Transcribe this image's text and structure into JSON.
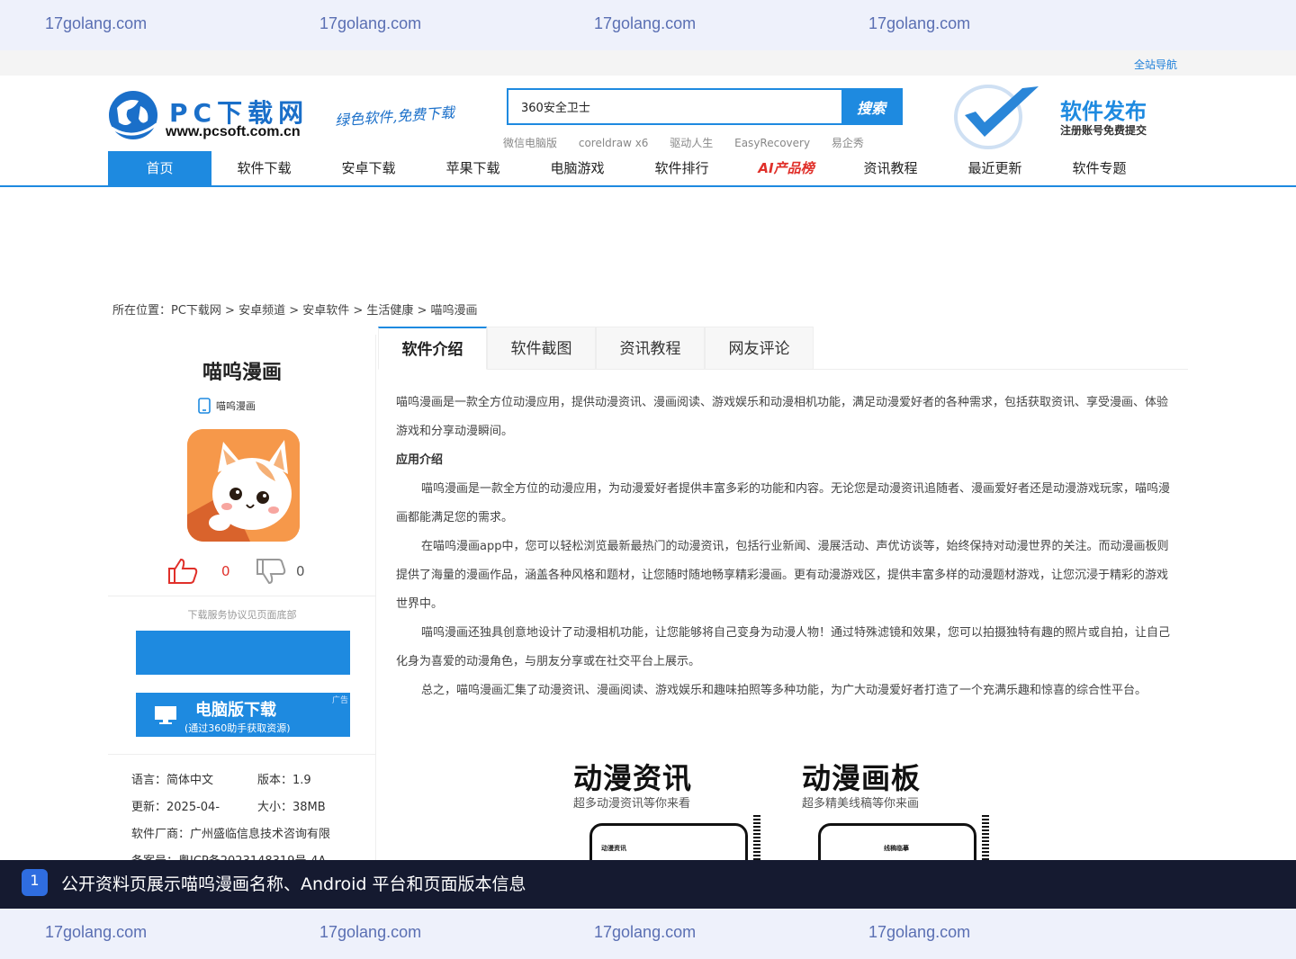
{
  "watermark": {
    "text": "17golang.com"
  },
  "topstrip": {
    "nav_all": "全站导航"
  },
  "header": {
    "logo_text": "PC下载网",
    "logo_url": "www.pcsoft.com.cn",
    "slogan": "绿色软件,免费下载",
    "search_value": "360安全卫士",
    "search_button": "搜索",
    "hot_words": [
      "微信电脑版",
      "coreldraw x6",
      "驱动人生",
      "EasyRecovery",
      "易企秀"
    ],
    "promo_title": "软件发布",
    "promo_sub": "注册账号免费提交"
  },
  "nav": {
    "items": [
      "首页",
      "软件下载",
      "安卓下载",
      "苹果下载",
      "电脑游戏",
      "软件排行",
      "AI产品榜",
      "资讯教程",
      "最近更新",
      "软件专题"
    ]
  },
  "breadcrumb": "所在位置：PC下载网 > 安卓频道 > 安卓软件 > 生活健康 > 喵呜漫画",
  "sidebar": {
    "app_title": "喵呜漫画",
    "platform_label": "喵呜漫画",
    "likes": "0",
    "dislikes": "0",
    "agreement": "下载服务协议见页面底部",
    "pc_download_main": "电脑版下载",
    "pc_download_sub": "(通过360助手获取资源)",
    "ad_label": "广告",
    "info": {
      "language": "语言：简体中文",
      "version": "版本：1.9",
      "updated": "更新：2025-04-",
      "size": "大小：38MB",
      "vendor": "软件厂商：广州盛临信息技术咨询有限",
      "record": "备案号：粤ICP备2023148319号-4A"
    }
  },
  "tabs": [
    "软件介绍",
    "软件截图",
    "资讯教程",
    "网友评论"
  ],
  "content": {
    "intro": "喵呜漫画是一款全方位动漫应用，提供动漫资讯、漫画阅读、游戏娱乐和动漫相机功能，满足动漫爱好者的各种需求，包括获取资讯、享受漫画、体验游戏和分享动漫瞬间。",
    "heading": "应用介绍",
    "p1": "喵呜漫画是一款全方位的动漫应用，为动漫爱好者提供丰富多彩的功能和内容。无论您是动漫资讯追随者、漫画爱好者还是动漫游戏玩家，喵呜漫画都能满足您的需求。",
    "p2": "在喵呜漫画app中，您可以轻松浏览最新最热门的动漫资讯，包括行业新闻、漫展活动、声优访谈等，始终保持对动漫世界的关注。而动漫画板则提供了海量的漫画作品，涵盖各种风格和题材，让您随时随地畅享精彩漫画。更有动漫游戏区，提供丰富多样的动漫题材游戏，让您沉浸于精彩的游戏世界中。",
    "p3": "喵呜漫画还独具创意地设计了动漫相机功能，让您能够将自己变身为动漫人物！通过特殊滤镜和效果，您可以拍摄独特有趣的照片或自拍，让自己化身为喜爱的动漫角色，与朋友分享或在社交平台上展示。",
    "p4": "总之，喵呜漫画汇集了动漫资讯、漫画阅读、游戏娱乐和趣味拍照等多种功能，为广大动漫爱好者打造了一个充满乐趣和惊喜的综合性平台。"
  },
  "screenshots": [
    {
      "title": "动漫资讯",
      "subtitle": "超多动漫资讯等你来看",
      "phone_label": "动漫资讯"
    },
    {
      "title": "动漫画板",
      "subtitle": "超多精美线稿等你来画",
      "phone_label": "线稿临摹"
    }
  ],
  "caption": {
    "number": "1",
    "text": "公开资料页展示喵呜漫画名称、Android 平台和页面版本信息"
  },
  "colors": {
    "brand": "#1e8ae0",
    "accent_red": "#e0302a",
    "caption_bg": "#151a30"
  }
}
